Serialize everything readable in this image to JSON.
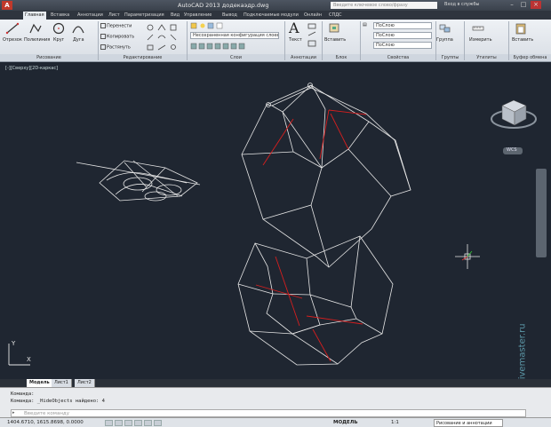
{
  "window": {
    "title": "AutoCAD 2013   додекаэдр.dwg",
    "search_placeholder": "Введите ключевое слово/фразу",
    "login": "Вход в службы"
  },
  "ribbon_tabs": [
    "Главная",
    "Вставка",
    "Аннотации",
    "Лист",
    "Параметризация",
    "Вид",
    "Управление",
    "Вывод",
    "Подключаемые модули",
    "Онлайн",
    "СПДС"
  ],
  "draw_tools": [
    "Отрезок",
    "Полилиния",
    "Круг",
    "Дуга"
  ],
  "modify_tools": [
    "Перенести",
    "Копировать",
    "Растянуть"
  ],
  "layer_dropdown": "Несохраненная конфигурация слоев",
  "annotation_label": "Текст",
  "insert_label": "Вставить",
  "properties": {
    "color": "ПоСлою",
    "linetype": "ПоСлою",
    "lineweight": "ПоСлою"
  },
  "groups_label": "Группа",
  "measure_label": "Измерить",
  "paste_label": "Вставить",
  "group_labels": [
    "Рисование",
    "Редактирование",
    "Слои",
    "Аннотации",
    "Блок",
    "Свойства",
    "Группы",
    "Утилиты",
    "Буфер обмена"
  ],
  "viewport_label": "[-][Сверху][2D-каркас]",
  "viewcube_label": "WCS",
  "layout_tabs": [
    "Модель",
    "Лист1",
    "Лист2"
  ],
  "command_lines": [
    "Команда:",
    "Команда:  _HideObjects найдено: 4"
  ],
  "command_placeholder": "Введите команду",
  "status": {
    "coords": "1404.6710, 1615.8698, 0.0000",
    "model": "МОДЕЛЬ",
    "scale": "1:1",
    "workspace": "Рисование и аннотации"
  },
  "watermark": "er.livemaster.ru",
  "colors": {
    "drawing_lines": "#e8e8e8",
    "accent_lines": "#d81e1e",
    "background": "#1f2631"
  }
}
